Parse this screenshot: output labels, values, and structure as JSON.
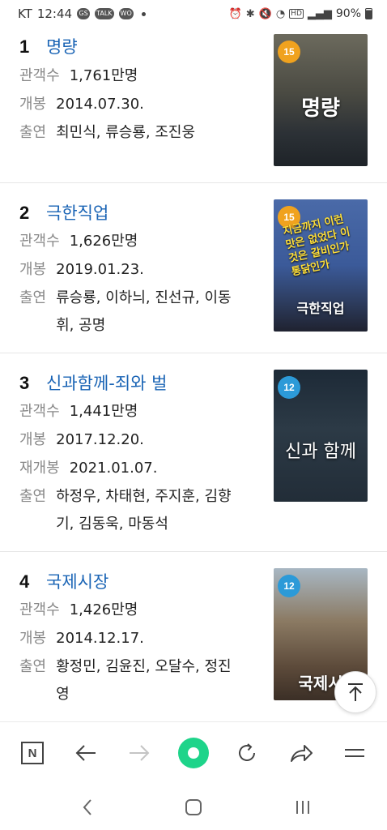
{
  "status_bar": {
    "carrier": "KT",
    "time": "12:44",
    "app_badges": [
      "GS",
      "TALK",
      "WO"
    ],
    "battery": "90%"
  },
  "movies": [
    {
      "rank": "1",
      "title": "명량",
      "audience_label": "관객수",
      "audience": "1,761만명",
      "release_label": "개봉",
      "release": "2014.07.30.",
      "cast_label": "출연",
      "cast": "최민식, 류승룡, 조진웅",
      "age": "15",
      "poster_title": "명량"
    },
    {
      "rank": "2",
      "title": "극한직업",
      "audience_label": "관객수",
      "audience": "1,626만명",
      "release_label": "개봉",
      "release": "2019.01.23.",
      "cast_label": "출연",
      "cast": "류승룡, 이하늬, 진선규, 이동휘, 공명",
      "age": "15",
      "poster_title": "극한직업",
      "poster_slogan": "지금까지 이런 맛은 없었다 이것은 갈비인가 통닭인가"
    },
    {
      "rank": "3",
      "title": "신과함께-죄와 벌",
      "audience_label": "관객수",
      "audience": "1,441만명",
      "release_label": "개봉",
      "release": "2017.12.20.",
      "rerelease_label": "재개봉",
      "rerelease": "2021.01.07.",
      "cast_label": "출연",
      "cast": "하정우, 차태현, 주지훈, 김향기, 김동욱, 마동석",
      "age": "12",
      "poster_title": "신과 함께"
    },
    {
      "rank": "4",
      "title": "국제시장",
      "audience_label": "관객수",
      "audience": "1,426만명",
      "release_label": "개봉",
      "release": "2014.12.17.",
      "cast_label": "출연",
      "cast": "황정민, 김윤진, 오달수, 정진영",
      "age": "12",
      "poster_title": "국제시"
    }
  ],
  "toolbar": {
    "icons": [
      "naver-n-icon",
      "back-arrow-icon",
      "forward-arrow-icon",
      "green-dot-icon",
      "refresh-icon",
      "share-icon",
      "menu-icon"
    ]
  },
  "colors": {
    "title_link": "#1a64b5",
    "age_15": "#f0a21e",
    "age_12": "#2c9ad8",
    "green_button": "#1ed48a"
  }
}
